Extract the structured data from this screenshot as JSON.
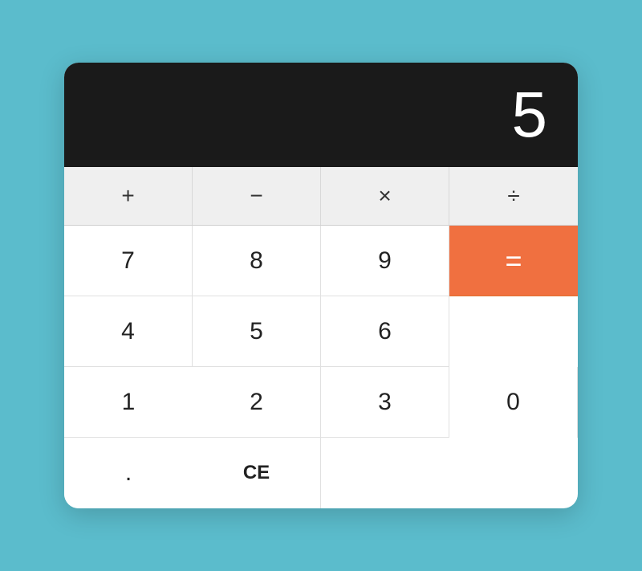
{
  "calculator": {
    "display": {
      "value": "5"
    },
    "operators": [
      {
        "label": "+",
        "id": "plus"
      },
      {
        "label": "−",
        "id": "minus"
      },
      {
        "label": "×",
        "id": "multiply"
      },
      {
        "label": "÷",
        "id": "divide"
      }
    ],
    "buttons": [
      {
        "label": "7",
        "id": "seven"
      },
      {
        "label": "8",
        "id": "eight"
      },
      {
        "label": "9",
        "id": "nine"
      },
      {
        "label": "4",
        "id": "four"
      },
      {
        "label": "5",
        "id": "five"
      },
      {
        "label": "6",
        "id": "six"
      },
      {
        "label": "1",
        "id": "one"
      },
      {
        "label": "2",
        "id": "two"
      },
      {
        "label": "3",
        "id": "three"
      },
      {
        "label": "0",
        "id": "zero"
      },
      {
        "label": ".",
        "id": "dot"
      },
      {
        "label": "CE",
        "id": "ce"
      }
    ],
    "equals": {
      "label": "="
    },
    "colors": {
      "display_bg": "#1a1a1a",
      "equals_bg": "#f07040",
      "operators_bg": "#efefef",
      "num_bg": "#ffffff"
    }
  }
}
